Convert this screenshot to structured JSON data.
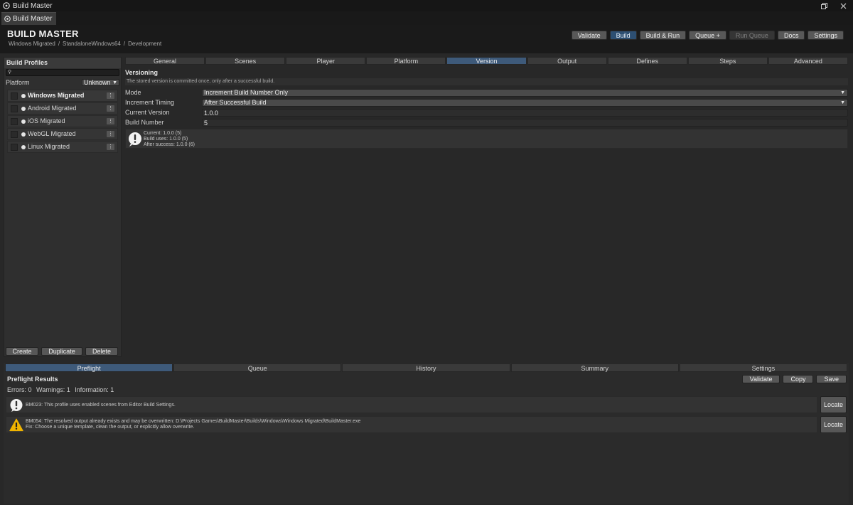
{
  "window": {
    "title": "Build Master",
    "icon": "unity-icon",
    "controls": [
      "restore-icon",
      "close-icon"
    ]
  },
  "doc_tab": {
    "label": "Build Master",
    "icon": "unity-icon"
  },
  "header": {
    "title": "BUILD MASTER",
    "breadcrumb": [
      "Windows Migrated",
      "StandaloneWindows64",
      "Development"
    ],
    "toolbar": {
      "validate": "Validate",
      "build": "Build",
      "build_run": "Build & Run",
      "queue_add": "Queue +",
      "run_queue": "Run Queue",
      "docs": "Docs",
      "settings": "Settings"
    }
  },
  "profiles_panel": {
    "title": "Build Profiles",
    "search_icon": "search-icon",
    "platform_label": "Platform",
    "platform_value": "Unknown",
    "items": [
      {
        "label": "Windows Migrated",
        "selected": true
      },
      {
        "label": "Android Migrated",
        "selected": false
      },
      {
        "label": "iOS Migrated",
        "selected": false
      },
      {
        "label": "WebGL Migrated",
        "selected": false
      },
      {
        "label": "Linux Migrated",
        "selected": false
      }
    ],
    "item_menu_glyph": "⋮",
    "actions": {
      "create": "Create",
      "duplicate": "Duplicate",
      "delete": "Delete"
    }
  },
  "main": {
    "tabs": [
      "General",
      "Scenes",
      "Player",
      "Platform",
      "Version",
      "Output",
      "Defines",
      "Steps",
      "Advanced"
    ],
    "active_tab": "Version",
    "section_title": "Versioning",
    "hint": "The stored version is committed once, only after a successful build.",
    "fields": {
      "mode": {
        "label": "Mode",
        "value": "Increment Build Number Only"
      },
      "timing": {
        "label": "Increment Timing",
        "value": "After Successful Build"
      },
      "current_version": {
        "label": "Current Version",
        "value": "1.0.0"
      },
      "build_number": {
        "label": "Build Number",
        "value": "5"
      }
    },
    "info": {
      "icon": "info-icon",
      "lines": [
        "Current: 1.0.0 (5)",
        "Build uses: 1.0.0 (5)",
        "After success: 1.0.0 (6)"
      ]
    }
  },
  "bottom": {
    "tabs": [
      "Preflight",
      "Queue",
      "History",
      "Summary",
      "Settings"
    ],
    "active_tab": "Preflight",
    "title": "Preflight Results",
    "actions": {
      "validate": "Validate",
      "copy": "Copy",
      "save": "Save"
    },
    "counts": {
      "errors": "Errors: 0",
      "warnings": "Warnings: 1",
      "information": "Information: 1"
    },
    "messages": [
      {
        "icon": "info-icon",
        "lines": [
          "BM023: This profile uses enabled scenes from Editor Build Settings."
        ],
        "button": "Locate"
      },
      {
        "icon": "warning-icon",
        "lines": [
          "BM054: The resolved output already exists and may be overwritten: D:\\Projects Games\\BuildMaster\\Builds\\Windows\\Windows Migrated\\BuildMaster.exe",
          "Fix: Choose a unique template, clean the output, or explicitly allow overwrite."
        ],
        "button": "Locate"
      }
    ]
  },
  "colors": {
    "accent": "#2d4f72",
    "tab_active": "#3e5a7a",
    "warning": "#f0b400"
  }
}
